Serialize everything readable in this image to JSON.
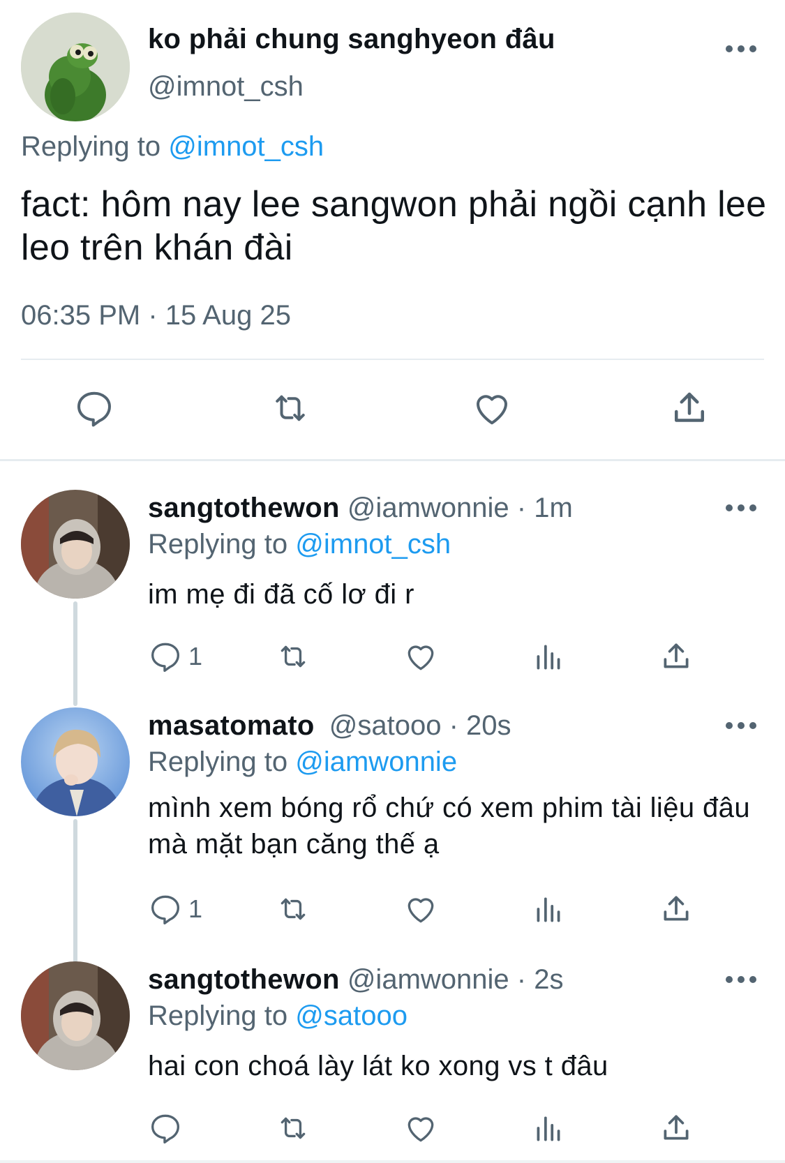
{
  "main_tweet": {
    "display_name": "ko phải chung sanghyeon đâu",
    "handle": "@imnot_csh",
    "replying_prefix": "Replying to",
    "replying_to": "@imnot_csh",
    "text": "fact: hôm nay lee sangwon phải ngồi cạnh lee leo trên khán đài",
    "timestamp": "06:35 PM · 15 Aug 25",
    "actions": [
      "reply-icon",
      "retweet-icon",
      "like-icon",
      "share-icon"
    ]
  },
  "replies": [
    {
      "display_name": "sangtothewon",
      "handle": "@iamwonnie",
      "time": "· 1m",
      "replying_prefix": "Replying to",
      "replying_to": "@imnot_csh",
      "text": "im mẹ đi đã cố lơ đi r",
      "reply_count": "1"
    },
    {
      "display_name": "masatomato",
      "handle": "@satooo",
      "time": "· 20s",
      "replying_prefix": "Replying to",
      "replying_to": "@iamwonnie",
      "text": "mình xem bóng rổ chứ có xem phim tài liệu đâu mà mặt bạn căng thế ạ",
      "reply_count": "1"
    },
    {
      "display_name": "sangtothewon",
      "handle": "@iamwonnie",
      "time": "· 2s",
      "replying_prefix": "Replying to",
      "replying_to": "@satooo",
      "text": "hai con choá lày lát ko xong vs t đâu",
      "reply_count": ""
    }
  ],
  "colors": {
    "text": "#0f1419",
    "secondary": "#536471",
    "link": "#1d9bf0",
    "divider": "#e6ecf0"
  }
}
